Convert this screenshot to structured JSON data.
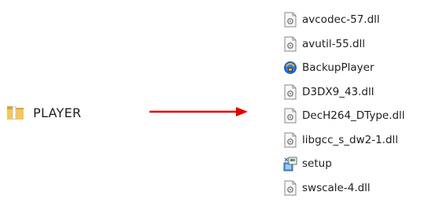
{
  "folder": {
    "label": "PLAYER",
    "icon": "folder-icon"
  },
  "files": [
    {
      "label": "avcodec-57.dll",
      "icon": "dll-file-icon"
    },
    {
      "label": "avutil-55.dll",
      "icon": "dll-file-icon"
    },
    {
      "label": "BackupPlayer",
      "icon": "app-icon"
    },
    {
      "label": "D3DX9_43.dll",
      "icon": "dll-file-icon"
    },
    {
      "label": "DecH264_DType.dll",
      "icon": "dll-file-icon"
    },
    {
      "label": "libgcc_s_dw2-1.dll",
      "icon": "dll-file-icon"
    },
    {
      "label": "setup",
      "icon": "installer-icon"
    },
    {
      "label": "swscale-4.dll",
      "icon": "dll-file-icon"
    }
  ],
  "colors": {
    "arrow": "#e60000",
    "folder": "#e8b84a",
    "text": "#1e1e1e"
  }
}
